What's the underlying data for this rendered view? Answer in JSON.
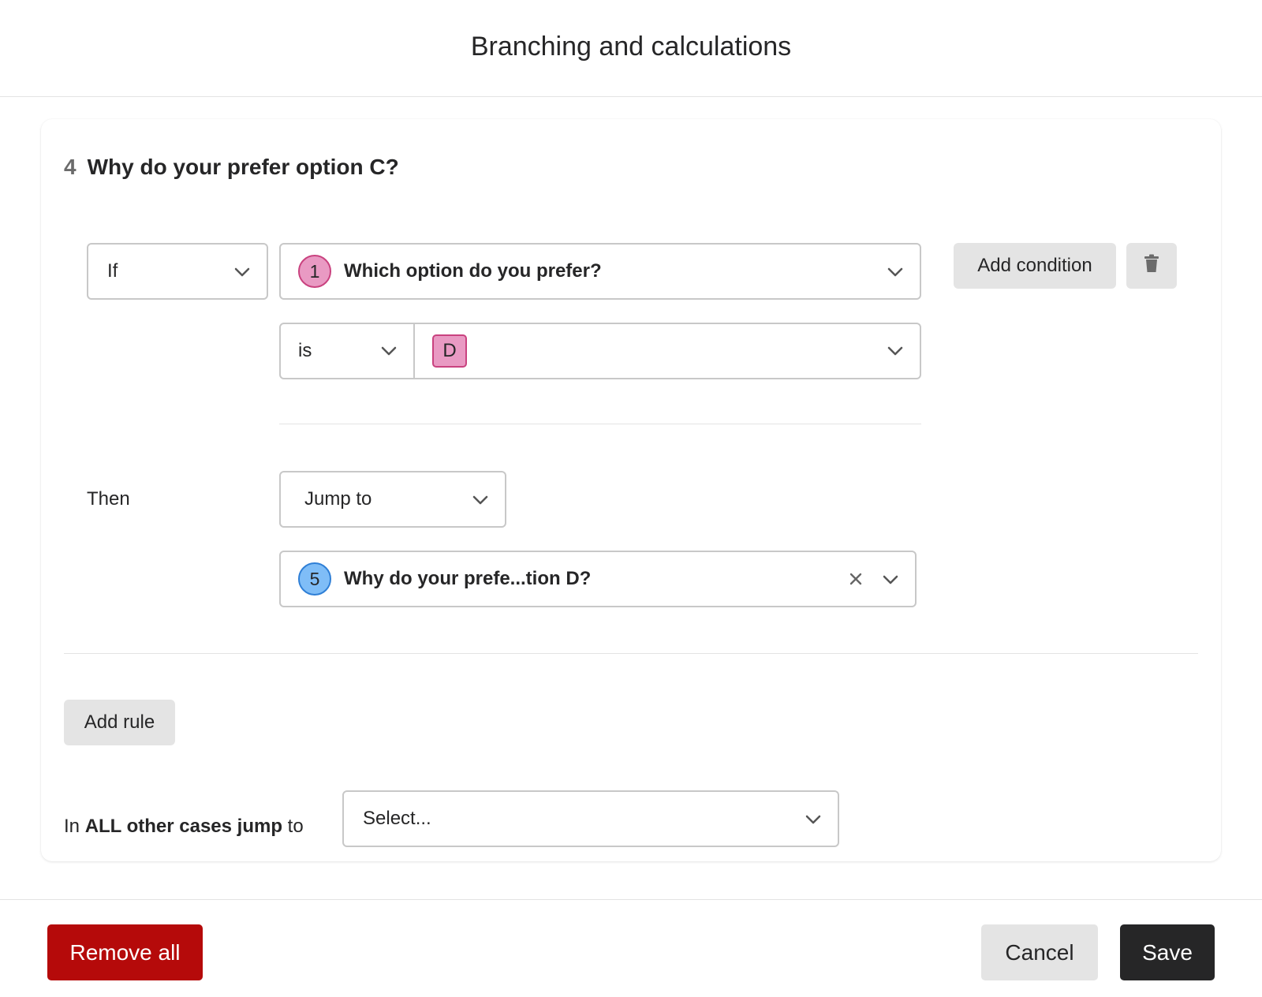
{
  "header": {
    "title": "Branching and calculations"
  },
  "question": {
    "number": "4",
    "title": "Why do your prefer option C?"
  },
  "rule": {
    "if_label": "If",
    "condition_question": {
      "number": "1",
      "title": "Which option do you prefer?",
      "badge_color": "#e99ac3"
    },
    "operator": "is",
    "value_tag": "D",
    "then_label": "Then",
    "action": "Jump to",
    "target_question": {
      "number": "5",
      "title": "Why do your prefe...tion D?",
      "badge_color": "#7fbdf7"
    },
    "add_condition_label": "Add condition",
    "delete_icon": "trash-icon"
  },
  "add_rule_label": "Add rule",
  "otherwise": {
    "prefix": "In ",
    "bold": "ALL other cases jump",
    "suffix": " to",
    "placeholder": "Select..."
  },
  "footer": {
    "remove_all_label": "Remove all",
    "cancel_label": "Cancel",
    "save_label": "Save"
  },
  "colors": {
    "danger": "#b50a0a",
    "primary_dark": "#262627",
    "secondary_bg": "#e4e4e4"
  }
}
